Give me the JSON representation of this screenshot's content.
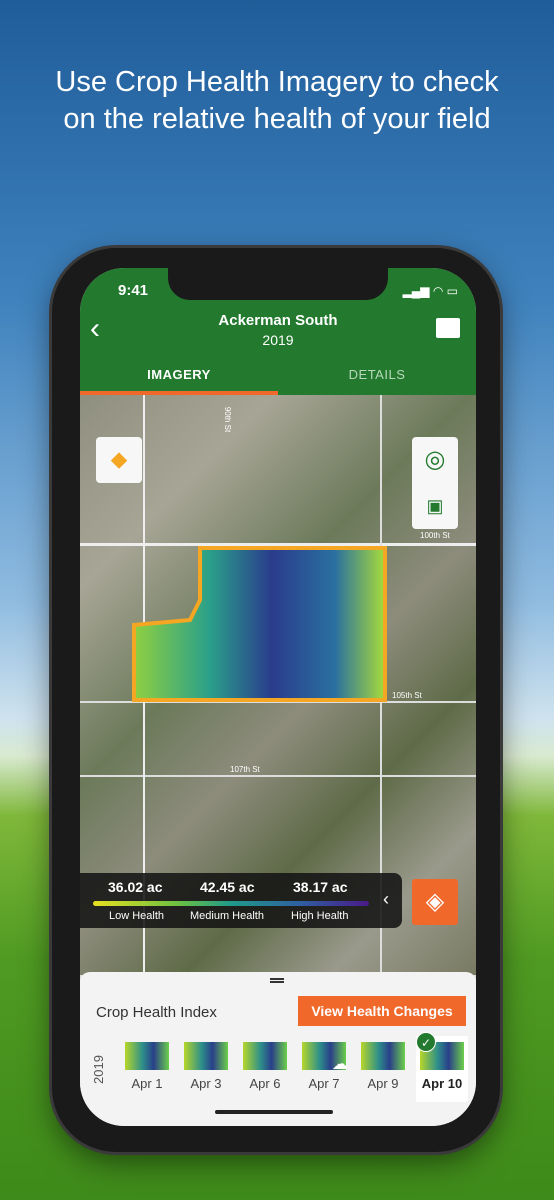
{
  "headline": "Use Crop Health Imagery to check on the relative health of your field",
  "status": {
    "time": "9:41"
  },
  "header": {
    "title": "Ackerman South",
    "subtitle": "2019"
  },
  "tabs": [
    {
      "label": "IMAGERY",
      "active": true
    },
    {
      "label": "DETAILS",
      "active": false
    }
  ],
  "map": {
    "streets": [
      "90th St",
      "100th St",
      "105th St",
      "107th St"
    ]
  },
  "legend": {
    "values": [
      "36.02 ac",
      "42.45 ac",
      "38.17 ac"
    ],
    "labels": [
      "Low Health",
      "Medium Health",
      "High Health"
    ]
  },
  "sheet": {
    "title": "Crop Health Index",
    "cta": "View Health Changes",
    "year": "2019",
    "dates": [
      {
        "label": "Apr 1"
      },
      {
        "label": "Apr 3"
      },
      {
        "label": "Apr 6"
      },
      {
        "label": "Apr 7",
        "cloudy": true
      },
      {
        "label": "Apr 9"
      },
      {
        "label": "Apr 10",
        "selected": true
      }
    ]
  },
  "colors": {
    "header": "#237a2e",
    "accent": "#f0692b",
    "field_outline": "#f5a623"
  }
}
